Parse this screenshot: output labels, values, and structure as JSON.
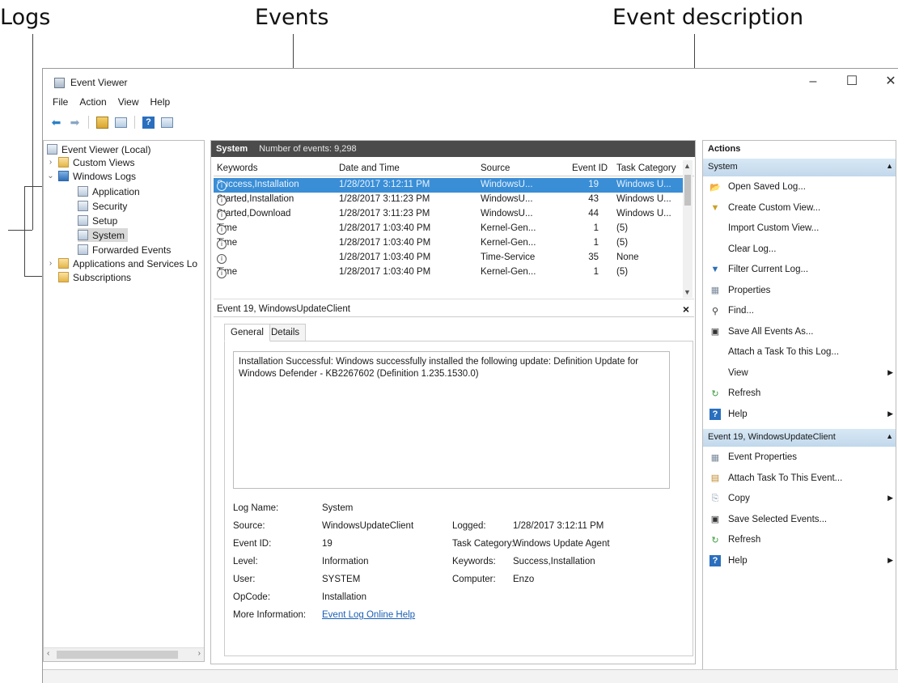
{
  "callouts": {
    "logs": "Logs",
    "events": "Events",
    "description": "Event description"
  },
  "window": {
    "title": "Event Viewer",
    "minimize": "–",
    "maximize": "☐",
    "close": "✕"
  },
  "menu": [
    "File",
    "Action",
    "View",
    "Help"
  ],
  "tree": {
    "root": "Event Viewer (Local)",
    "custom_views": "Custom Views",
    "windows_logs": "Windows Logs",
    "logs": [
      "Application",
      "Security",
      "Setup",
      "System",
      "Forwarded Events"
    ],
    "apps_services": "Applications and Services Lo",
    "subscriptions": "Subscriptions",
    "selected": "System"
  },
  "log_header": {
    "name": "System",
    "count": "Number of events: 9,298"
  },
  "columns": [
    "Keywords",
    "Date and Time",
    "Source",
    "Event ID",
    "Task Category"
  ],
  "events": [
    {
      "keywords": "Success,Installation",
      "date": "1/28/2017 3:12:11 PM",
      "source": "WindowsU...",
      "id": "19",
      "category": "Windows U...",
      "selected": true
    },
    {
      "keywords": "Started,Installation",
      "date": "1/28/2017 3:11:23 PM",
      "source": "WindowsU...",
      "id": "43",
      "category": "Windows U..."
    },
    {
      "keywords": "Started,Download",
      "date": "1/28/2017 3:11:23 PM",
      "source": "WindowsU...",
      "id": "44",
      "category": "Windows U..."
    },
    {
      "keywords": "Time",
      "date": "1/28/2017 1:03:40 PM",
      "source": "Kernel-Gen...",
      "id": "1",
      "category": "(5)"
    },
    {
      "keywords": "Time",
      "date": "1/28/2017 1:03:40 PM",
      "source": "Kernel-Gen...",
      "id": "1",
      "category": "(5)"
    },
    {
      "keywords": "",
      "date": "1/28/2017 1:03:40 PM",
      "source": "Time-Service",
      "id": "35",
      "category": "None"
    },
    {
      "keywords": "Time",
      "date": "1/28/2017 1:03:40 PM",
      "source": "Kernel-Gen...",
      "id": "1",
      "category": "(5)"
    }
  ],
  "detail": {
    "title": "Event 19, WindowsUpdateClient",
    "tabs": [
      "General",
      "Details"
    ],
    "description": "Installation Successful: Windows successfully installed the following update: Definition Update for Windows Defender - KB2267602 (Definition 1.235.1530.0)",
    "labels": {
      "log_name": "Log Name:",
      "source": "Source:",
      "event_id": "Event ID:",
      "level": "Level:",
      "user": "User:",
      "opcode": "OpCode:",
      "more_info": "More Information:",
      "logged": "Logged:",
      "task_category": "Task Category:",
      "keywords": "Keywords:",
      "computer": "Computer:"
    },
    "values": {
      "log_name": "System",
      "source": "WindowsUpdateClient",
      "event_id": "19",
      "level": "Information",
      "user": "SYSTEM",
      "opcode": "Installation",
      "more_info": "Event Log Online Help",
      "logged": "1/28/2017 3:12:11 PM",
      "task_category": "Windows Update Agent",
      "keywords": "Success,Installation",
      "computer": "Enzo"
    }
  },
  "actions": {
    "header": "Actions",
    "section1": "System",
    "items1": [
      "Open Saved Log...",
      "Create Custom View...",
      "Import Custom View...",
      "Clear Log...",
      "Filter Current Log...",
      "Properties",
      "Find...",
      "Save All Events As...",
      "Attach a Task To this Log...",
      "View",
      "Refresh",
      "Help"
    ],
    "section2": "Event 19, WindowsUpdateClient",
    "items2": [
      "Event Properties",
      "Attach Task To This Event...",
      "Copy",
      "Save Selected Events...",
      "Refresh",
      "Help"
    ]
  },
  "colors": {
    "selection": "#3a8ed6",
    "header_bg": "#4b4b4b",
    "section_bg": "#c8dcee"
  }
}
